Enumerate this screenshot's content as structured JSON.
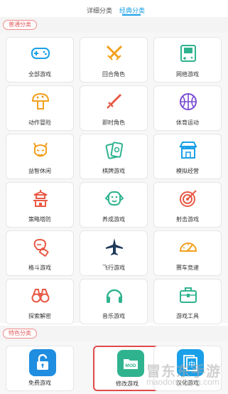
{
  "tabs": {
    "detail": "详细分类",
    "classic": "经典分类"
  },
  "sections": {
    "common": "普通分类",
    "special": "特色分类"
  },
  "categories": [
    {
      "label": "全部游戏",
      "icon": "gamepad-icon"
    },
    {
      "label": "回合角色",
      "icon": "crossed-swords-icon"
    },
    {
      "label": "网络游戏",
      "icon": "game-console-icon"
    },
    {
      "label": "动作冒险",
      "icon": "mushroom-icon"
    },
    {
      "label": "即时角色",
      "icon": "sword-icon"
    },
    {
      "label": "体育运动",
      "icon": "basketball-icon"
    },
    {
      "label": "益智休闲",
      "icon": "devil-icon"
    },
    {
      "label": "棋牌游戏",
      "icon": "cards-icon"
    },
    {
      "label": "模拟经营",
      "icon": "shop-icon"
    },
    {
      "label": "策略塔防",
      "icon": "pagoda-icon"
    },
    {
      "label": "养成游戏",
      "icon": "pet-face-icon"
    },
    {
      "label": "射击游戏",
      "icon": "target-icon"
    },
    {
      "label": "格斗游戏",
      "icon": "boxing-glove-icon"
    },
    {
      "label": "飞行游戏",
      "icon": "airplane-icon"
    },
    {
      "label": "赛车竞速",
      "icon": "speedometer-icon"
    },
    {
      "label": "探索解密",
      "icon": "binoculars-icon"
    },
    {
      "label": "音乐游戏",
      "icon": "headphones-icon"
    },
    {
      "label": "游戏工具",
      "icon": "toolbox-icon"
    }
  ],
  "special_categories": [
    {
      "label": "免费游戏",
      "icon": "unlock-icon"
    },
    {
      "label": "修改游戏",
      "icon": "mod-folder-icon",
      "badge": "MOD"
    },
    {
      "label": "汉化游戏",
      "icon": "chinese-char-icon",
      "badge": "中"
    }
  ],
  "watermark": {
    "line1": "冒东东手游",
    "line2": "maodongdong.com"
  },
  "colors": {
    "accent": "#1aa0e8",
    "icon_orange": "#f2a01e",
    "icon_green": "#2fb38f",
    "icon_purple": "#7a4dd1",
    "icon_red": "#e85a45",
    "icon_blue": "#1f8de0"
  }
}
